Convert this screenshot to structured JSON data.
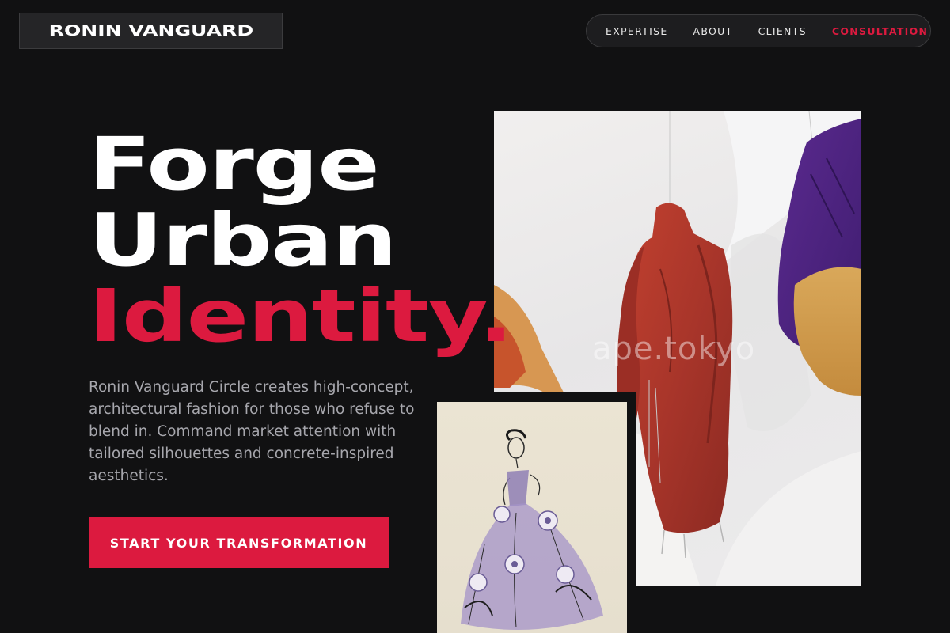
{
  "brand": {
    "name": "RONIN VANGUARD"
  },
  "nav": {
    "items": [
      "EXPERTISE",
      "ABOUT",
      "CLIENTS"
    ],
    "cta": "CONSULTATION"
  },
  "hero": {
    "line1": "Forge",
    "line2": "Urban",
    "line3": "Identity.",
    "description": "Ronin Vanguard Circle creates high-concept, architectural fashion for those who refuse to blend in. Command market attention with tailored silhouettes and concrete-inspired aesthetics.",
    "button": "START YOUR TRANSFORMATION"
  },
  "images": {
    "watermark": "ape.tokyo"
  },
  "colors": {
    "background": "#111112",
    "accent": "#dc1a3f",
    "text_muted": "#a7a7ad"
  }
}
